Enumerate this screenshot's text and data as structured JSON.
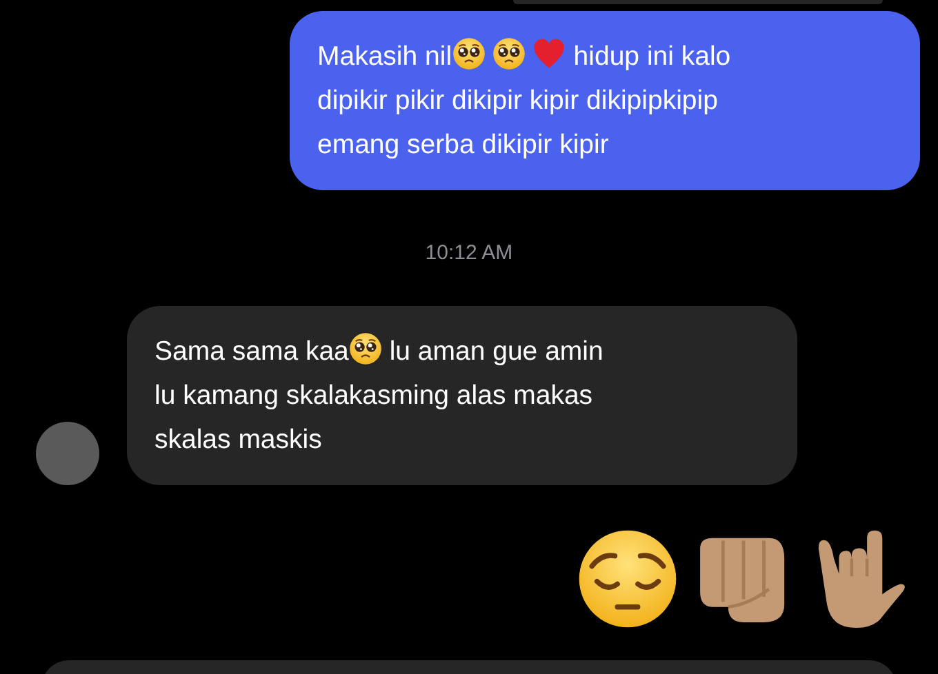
{
  "messages": [
    {
      "kind": "sent",
      "lines": [
        [
          {
            "kind": "text",
            "text": "Makasih nil"
          },
          {
            "kind": "pleading_face"
          },
          {
            "kind": "space"
          },
          {
            "kind": "pleading_face"
          },
          {
            "kind": "space"
          },
          {
            "kind": "heart"
          },
          {
            "kind": "text",
            "text": " hidup ini kalo"
          }
        ],
        [
          {
            "kind": "text",
            "text": "dipikir pikir dikipir kipir dikipipkipip"
          }
        ],
        [
          {
            "kind": "text",
            "text": "emang serba dikipir kipir"
          }
        ]
      ]
    },
    {
      "kind": "timestamp",
      "text": "10:12 AM"
    },
    {
      "kind": "received",
      "lines": [
        [
          {
            "kind": "text",
            "text": "Sama sama kaa"
          },
          {
            "kind": "pleading_face"
          },
          {
            "kind": "text",
            "text": " lu aman gue amin"
          }
        ],
        [
          {
            "kind": "text",
            "text": "lu kamang skalakasming alas makas"
          }
        ],
        [
          {
            "kind": "text",
            "text": "skalas maskis"
          }
        ]
      ]
    },
    {
      "kind": "emoji_only",
      "lines": [
        [
          {
            "kind": "pensive_face"
          },
          {
            "kind": "fist"
          },
          {
            "kind": "rock_hand"
          }
        ]
      ]
    }
  ]
}
